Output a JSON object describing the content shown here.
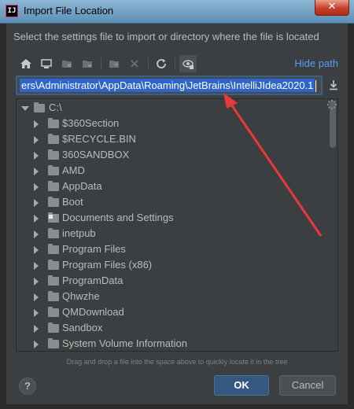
{
  "window": {
    "title": "Import File Location",
    "app_icon_text": "IJ",
    "close_symbol": "✕"
  },
  "dialog": {
    "instruction": "Select the settings file to import or directory where the file is located",
    "hide_path_label": "Hide path",
    "path_value": "ers\\Administrator\\AppData\\Roaming\\JetBrains\\IntelliJIdea2020.1",
    "drag_hint": "Drag and drop a file into the space above to quickly locate it in the tree",
    "ok_label": "OK",
    "cancel_label": "Cancel",
    "help_label": "?"
  },
  "toolbar": {
    "icons": [
      "home-icon",
      "desktop-icon",
      "project-icon",
      "module-icon",
      "new-folder-icon",
      "delete-icon",
      "refresh-icon",
      "show-hidden-icon"
    ]
  },
  "tree": {
    "root": "C:\\",
    "items": [
      "$360Section",
      "$RECYCLE.BIN",
      "360SANDBOX",
      "AMD",
      "AppData",
      "Boot",
      "Documents and Settings",
      "inetpub",
      "Program Files",
      "Program Files (x86)",
      "ProgramData",
      "Qhwzhe",
      "QMDownload",
      "Sandbox",
      "System Volume Information"
    ]
  },
  "colors": {
    "background": "#3c3f41",
    "accent": "#589df6",
    "selection": "#2f65ca",
    "ok_button": "#365880",
    "annotation_arrow": "#e8393a"
  }
}
